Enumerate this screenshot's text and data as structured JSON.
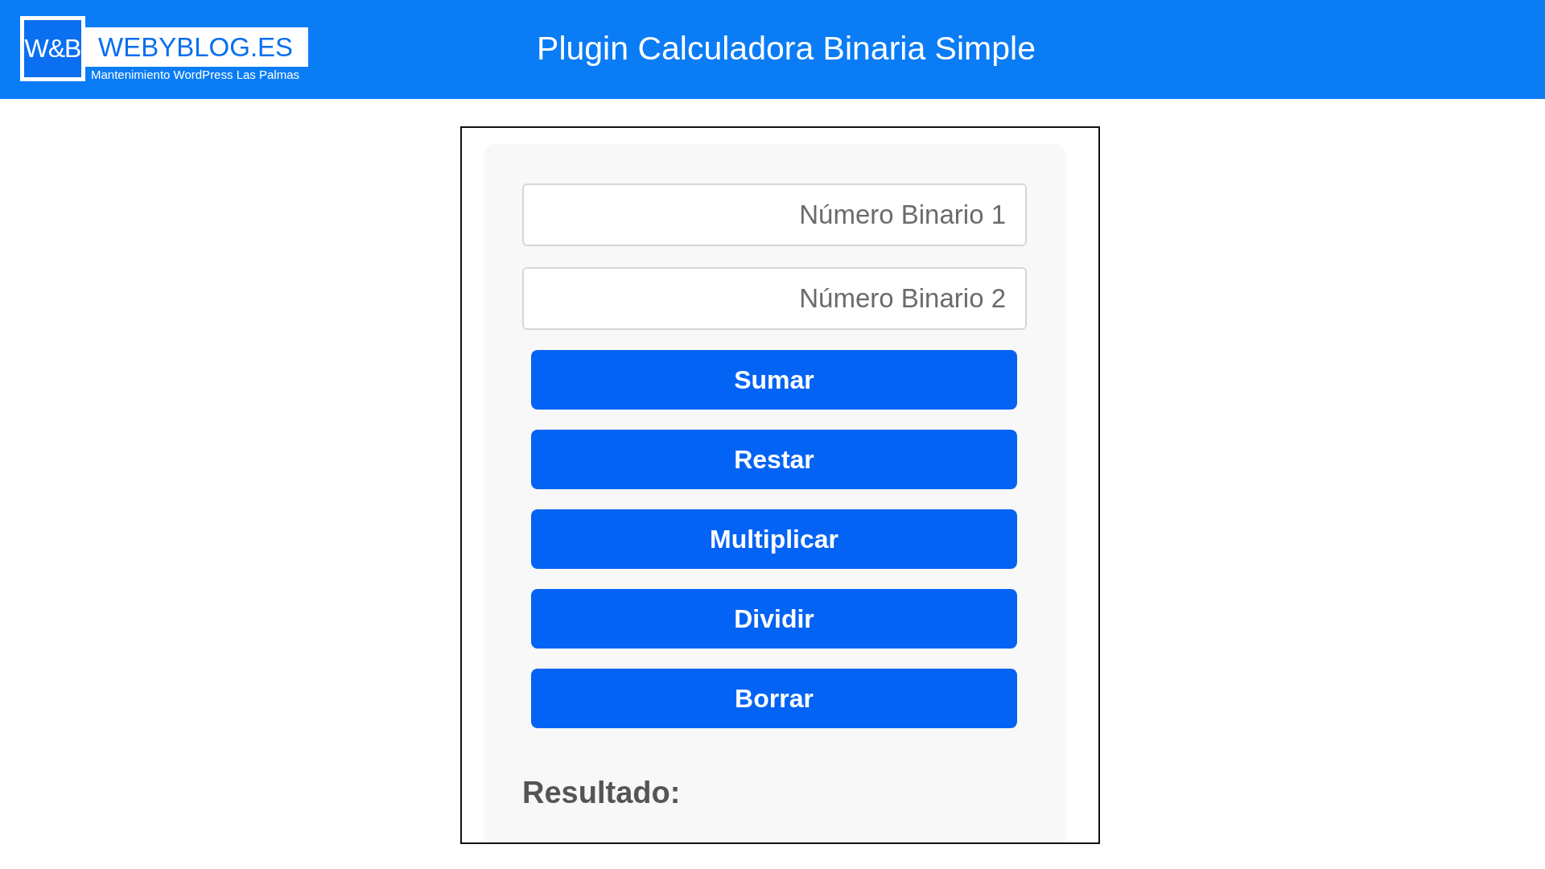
{
  "header": {
    "logo": {
      "mark": "W&B",
      "name": "WEBYBLOG.ES",
      "tagline": "Mantenimiento WordPress Las Palmas"
    },
    "title": "Plugin Calculadora Binaria Simple"
  },
  "calculator": {
    "fields": [
      {
        "placeholder": "Número Binario 1"
      },
      {
        "placeholder": "Número Binario 2"
      }
    ],
    "buttons": [
      "Sumar",
      "Restar",
      "Multiplicar",
      "Dividir",
      "Borrar"
    ],
    "result_label": "Resultado:"
  }
}
